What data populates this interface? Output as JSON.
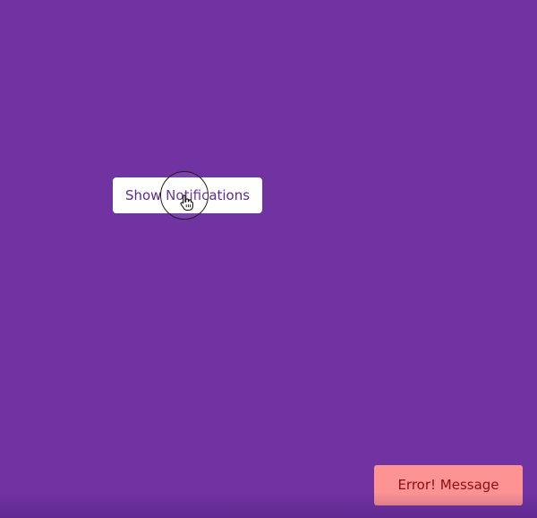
{
  "page": {
    "background_color": "#7132a2"
  },
  "main": {
    "show_button_label": "Show Notifications",
    "show_button_text_color": "#5c2a91",
    "show_button_bg_color": "#ffffff"
  },
  "cursor": {
    "icon": "hand-pointer-icon",
    "ring_icon": "click-ring-icon"
  },
  "notifications": [
    {
      "text": "Error! Message",
      "type": "error",
      "bg_color": "#fd9392",
      "text_color": "#8a0f14"
    }
  ]
}
